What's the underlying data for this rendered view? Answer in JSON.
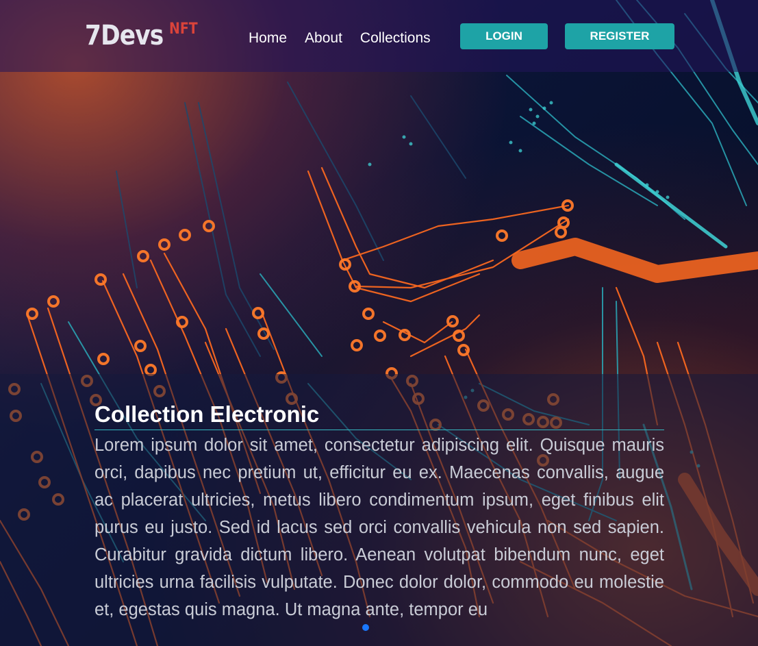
{
  "colors": {
    "accent": "#1ea3a6",
    "logo_sup": "#d9433a",
    "circuit_orange": "#ff6a1f",
    "circuit_teal": "#3fd3d6"
  },
  "header": {
    "logo_main": "7Devs",
    "logo_sup": "NFT",
    "nav": [
      "Home",
      "About",
      "Collections"
    ],
    "login_label": "LOGIN",
    "register_label": "REGISTER"
  },
  "main": {
    "title": "Collection Electronic",
    "body": "Lorem ipsum dolor sit amet, consectetur adipiscing elit. Quisque mauris orci, dapibus nec pretium ut, efficitur eu ex. Maecenas convallis, augue ac placerat ultricies, metus libero condimentum ipsum, eget finibus elit purus eu justo. Sed id lacus sed orci convallis vehicula non sed sapien. Curabitur gravida dictum libero. Aenean volutpat bibendum nunc, eget ultricies urna facilisis vulputate. Donec dolor dolor, commodo eu molestie et, egestas quis magna. Ut magna ante, tempor eu"
  }
}
